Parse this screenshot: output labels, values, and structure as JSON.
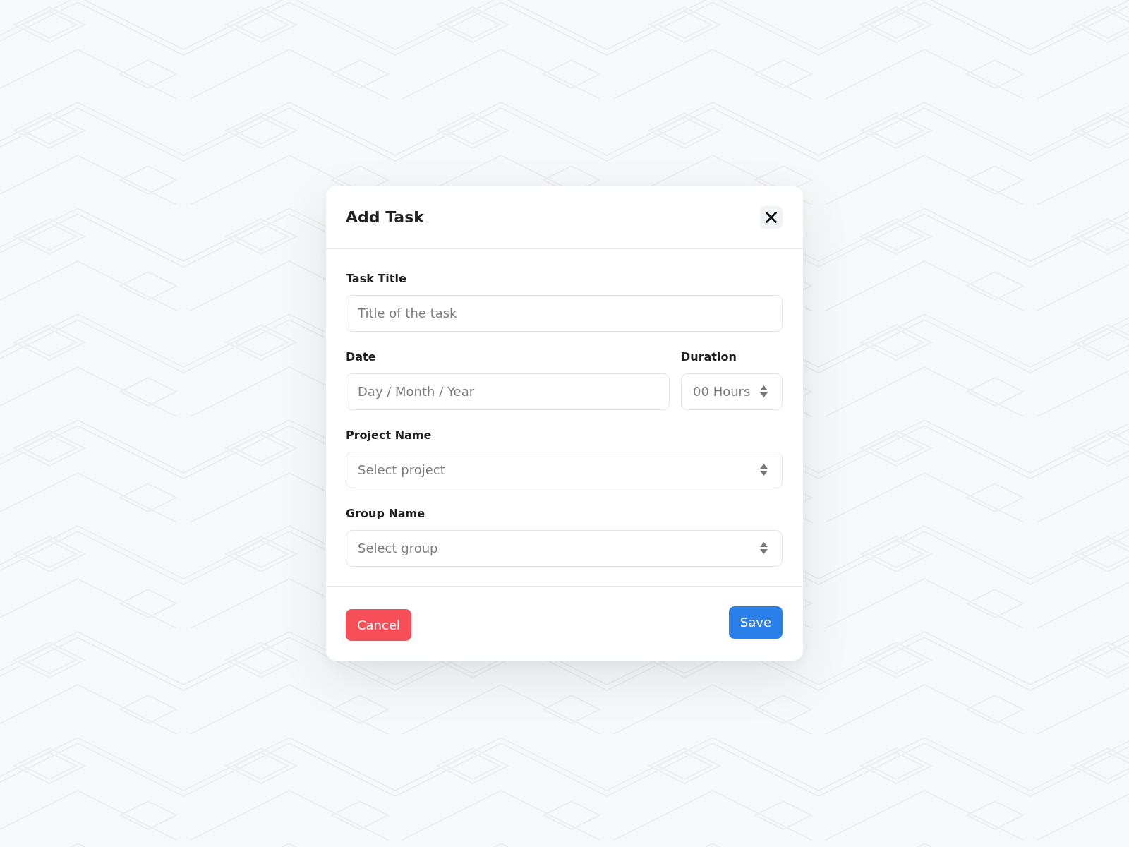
{
  "dialog": {
    "title": "Add Task",
    "rows": [
      {
        "fields": [
          {
            "kind": "text",
            "label": "Task Title",
            "placeholder": "Title of the task"
          }
        ]
      },
      {
        "fields": [
          {
            "kind": "date",
            "label": "Date",
            "placeholder": "Day / Month / Year"
          },
          {
            "kind": "select",
            "label": "Duration",
            "placeholder": "00 Hours"
          }
        ]
      },
      {
        "fields": [
          {
            "kind": "select",
            "label": "Project Name",
            "placeholder": "Select project"
          }
        ]
      },
      {
        "fields": [
          {
            "kind": "select",
            "label": "Group Name",
            "placeholder": "Select group"
          }
        ]
      }
    ],
    "buttons": [
      {
        "kind": "danger",
        "label": "Cancel"
      },
      {
        "kind": "primary",
        "label": "Save"
      }
    ]
  }
}
